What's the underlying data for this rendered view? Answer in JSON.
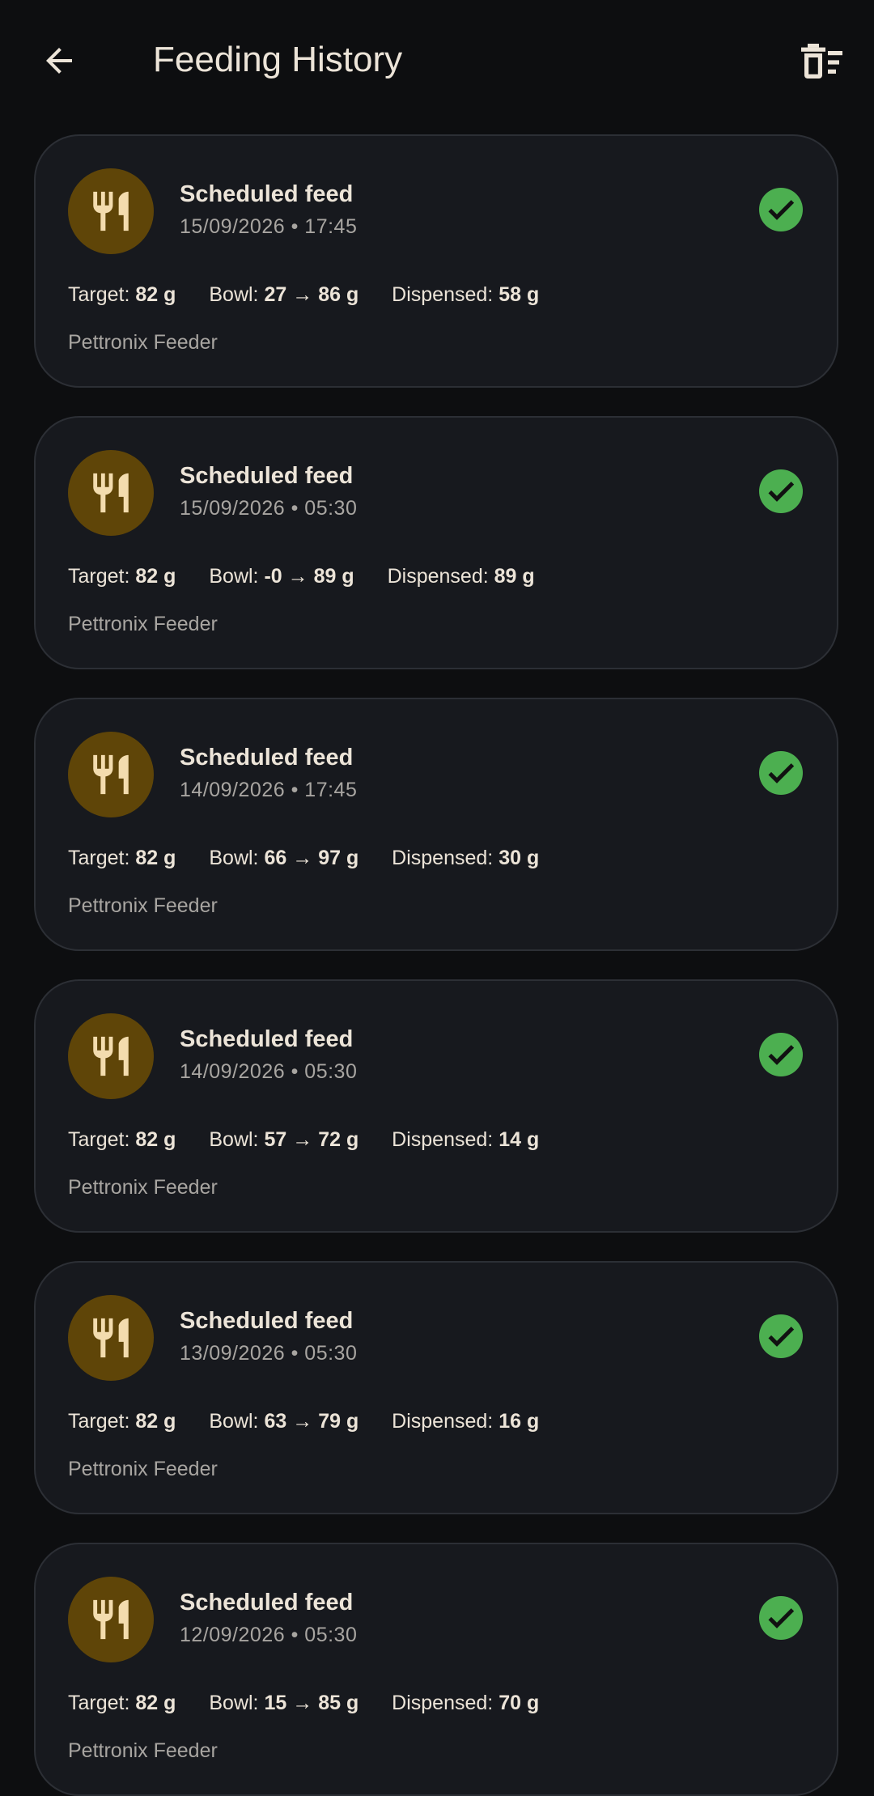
{
  "header": {
    "title": "Feeding History",
    "back_icon": "arrow-left-icon",
    "clear_icon": "delete-sweep-icon"
  },
  "colors": {
    "background": "#0d0e10",
    "card": "#17191e",
    "avatar": "#5f4508",
    "accent": "#f3dcae",
    "success": "#4caf50"
  },
  "labels": {
    "target": "Target:",
    "bowl": "Bowl:",
    "dispensed": "Dispensed:",
    "separator": "•",
    "arrow": "→"
  },
  "entries": [
    {
      "title": "Scheduled feed",
      "date": "15/09/2026",
      "time": "17:45",
      "target": "82 g",
      "bowl_from": "27",
      "bowl_to": "86 g",
      "dispensed": "58 g",
      "device": "Pettronix Feeder"
    },
    {
      "title": "Scheduled feed",
      "date": "15/09/2026",
      "time": "05:30",
      "target": "82 g",
      "bowl_from": "-0",
      "bowl_to": "89 g",
      "dispensed": "89 g",
      "device": "Pettronix Feeder"
    },
    {
      "title": "Scheduled feed",
      "date": "14/09/2026",
      "time": "17:45",
      "target": "82 g",
      "bowl_from": "66",
      "bowl_to": "97 g",
      "dispensed": "30 g",
      "device": "Pettronix Feeder"
    },
    {
      "title": "Scheduled feed",
      "date": "14/09/2026",
      "time": "05:30",
      "target": "82 g",
      "bowl_from": "57",
      "bowl_to": "72 g",
      "dispensed": "14 g",
      "device": "Pettronix Feeder"
    },
    {
      "title": "Scheduled feed",
      "date": "13/09/2026",
      "time": "05:30",
      "target": "82 g",
      "bowl_from": "63",
      "bowl_to": "79 g",
      "dispensed": "16 g",
      "device": "Pettronix Feeder"
    },
    {
      "title": "Scheduled feed",
      "date": "12/09/2026",
      "time": "05:30",
      "target": "82 g",
      "bowl_from": "15",
      "bowl_to": "85 g",
      "dispensed": "70 g",
      "device": "Pettronix Feeder"
    }
  ]
}
